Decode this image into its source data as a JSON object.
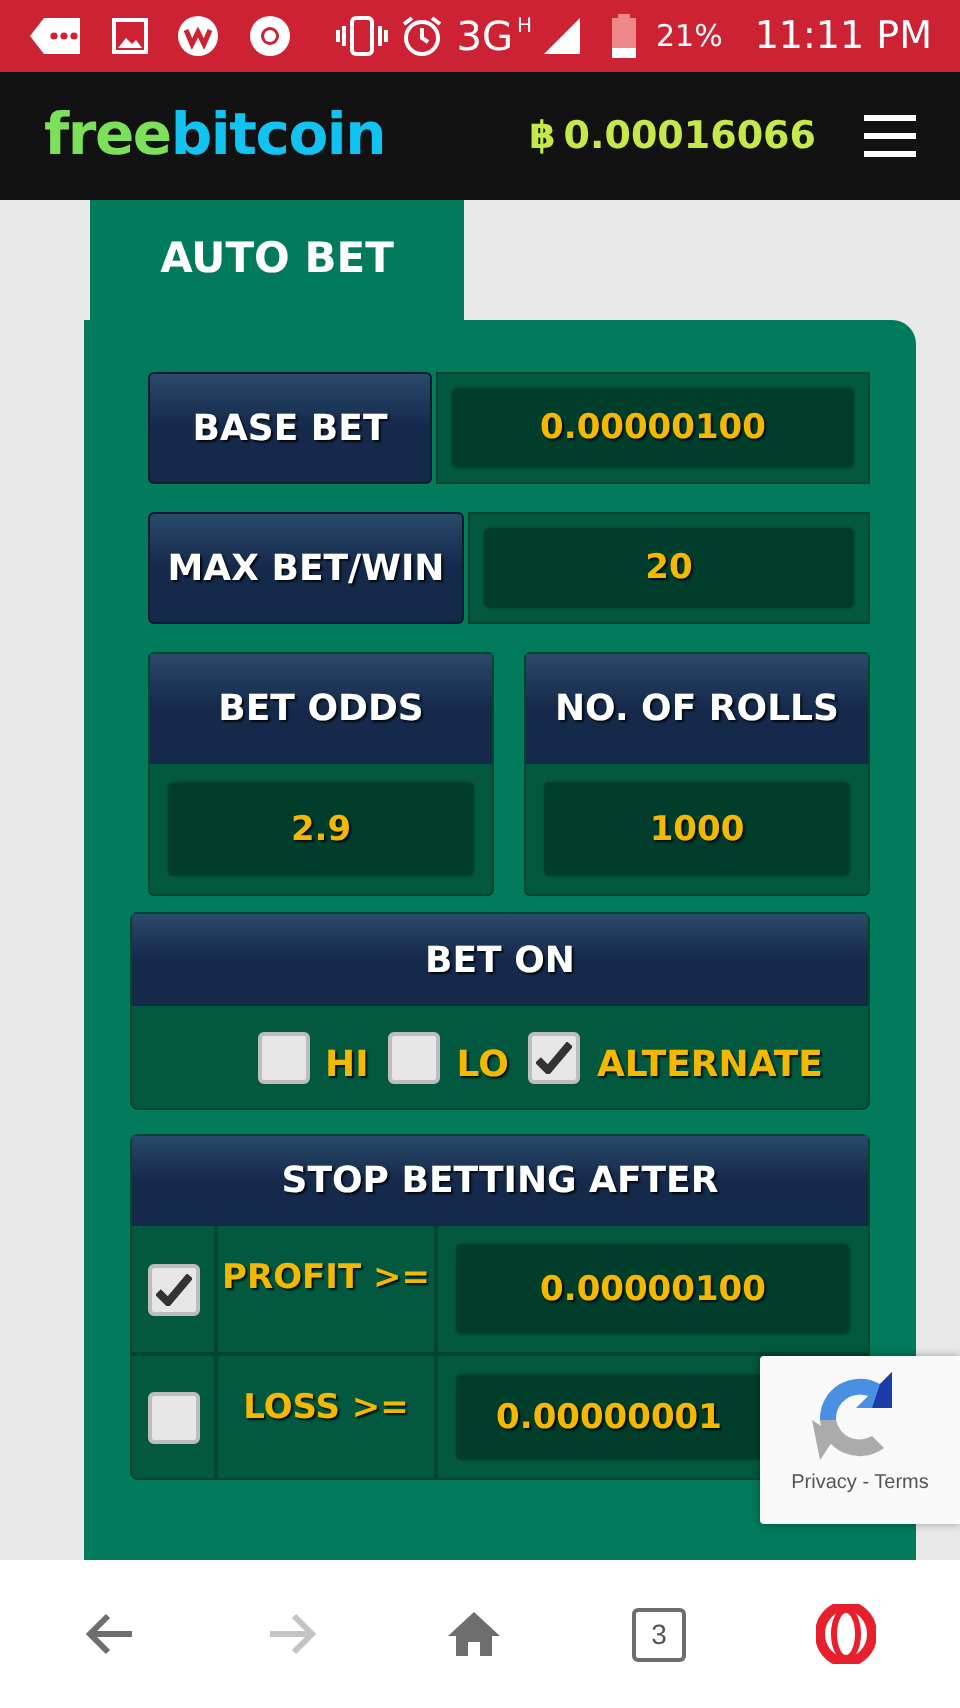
{
  "status_bar": {
    "network": "3G",
    "network_sub": "H",
    "battery": "21%",
    "time": "11:11 PM"
  },
  "header": {
    "logo_part_1": "free",
    "logo_part_2": "bitcoin",
    "currency_symbol": "฿",
    "balance": "0.00016066"
  },
  "tabs": [
    {
      "label": "AUTO BET",
      "selected": true
    }
  ],
  "base_bet": {
    "label": "BASE BET",
    "value": "0.00000100"
  },
  "max_bet": {
    "label": "MAX BET/WIN",
    "value": "20"
  },
  "pairs": [
    {
      "label": "BET ODDS",
      "value": "2.9"
    },
    {
      "label": "NO. OF ROLLS",
      "value": "1000"
    }
  ],
  "bet_on": {
    "title": "BET ON",
    "options": [
      {
        "label": "HI",
        "checked": false
      },
      {
        "label": "LO",
        "checked": false
      },
      {
        "label": "ALTERNATE",
        "checked": true
      }
    ]
  },
  "stop_betting": {
    "title": "STOP BETTING AFTER",
    "rows": [
      {
        "label": "PROFIT >=",
        "checked": true,
        "value": "0.00000100"
      },
      {
        "label": "LOSS >=",
        "checked": false,
        "value": "0.00000001"
      }
    ]
  },
  "recaptcha": {
    "links": "Privacy - Terms"
  },
  "browser_bar": {
    "tab_count": "3",
    "forward_disabled": true
  }
}
